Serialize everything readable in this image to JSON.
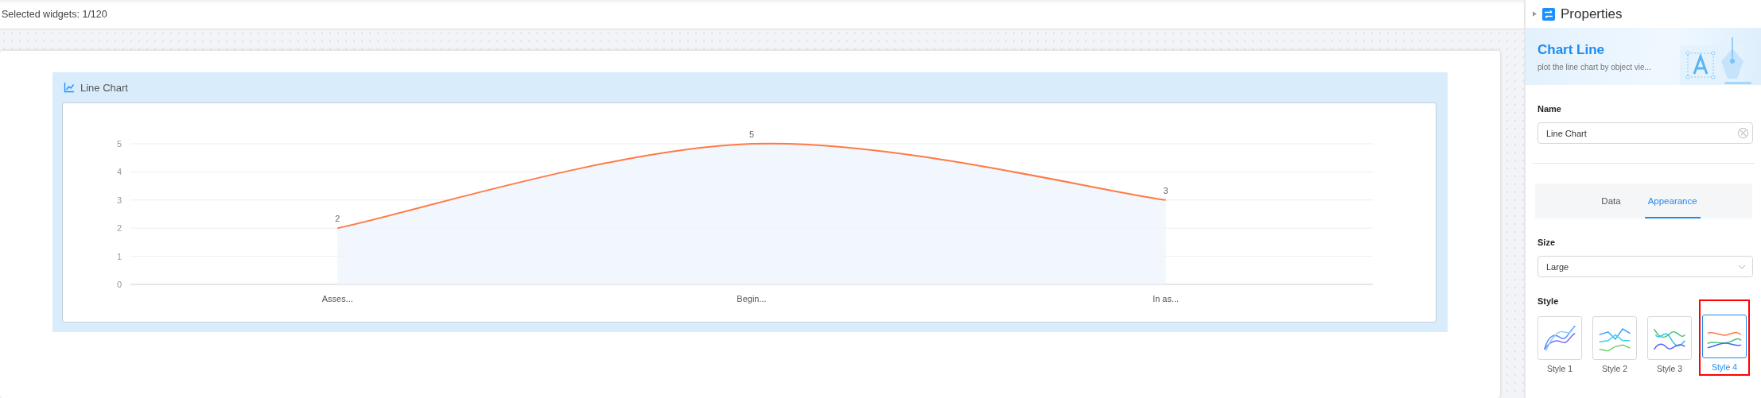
{
  "status": "Selected widgets: 1/120",
  "widget": {
    "title": "Line Chart",
    "chart_data": {
      "type": "area",
      "categories": [
        "Asses...",
        "Begin...",
        "In as..."
      ],
      "series": [
        {
          "color": "#ff7a45",
          "values": [
            2,
            5,
            3
          ]
        }
      ],
      "grid": true,
      "ylim": [
        0,
        5
      ],
      "yticks": [
        0,
        1,
        2,
        3,
        4,
        5
      ],
      "data_labels": true
    }
  },
  "panel": {
    "title": "Properties",
    "banner": {
      "title": "Chart Line",
      "subtitle": "plot the line chart by object vie..."
    },
    "name": {
      "label": "Name",
      "value": "Line Chart"
    },
    "tabs": [
      {
        "label": "Data",
        "selected": false
      },
      {
        "label": "Appearance",
        "selected": true
      }
    ],
    "size": {
      "label": "Size",
      "value": "Large"
    },
    "style": {
      "label": "Style",
      "options": [
        {
          "label": "Style 1",
          "selected": false
        },
        {
          "label": "Style 2",
          "selected": false
        },
        {
          "label": "Style 3",
          "selected": false
        },
        {
          "label": "Style 4",
          "selected": true
        }
      ]
    }
  }
}
